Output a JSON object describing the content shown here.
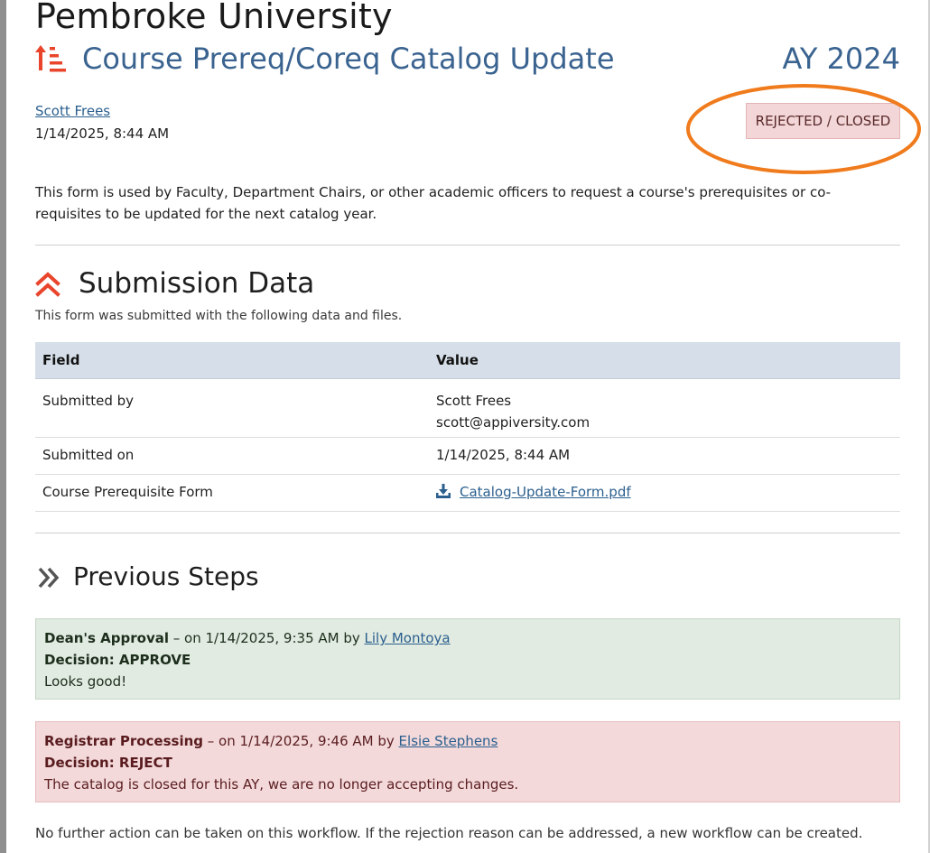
{
  "header": {
    "university": "Pembroke University",
    "course_title": "Course Prereq/Coreq Catalog Update",
    "academic_year": "AY 2024"
  },
  "submission_meta": {
    "submitter_name": "Scott Frees",
    "submitted_at": "1/14/2025, 8:44 AM",
    "status": "REJECTED / CLOSED"
  },
  "description": "This form is used by Faculty, Department Chairs, or other academic officers to request a course's prerequisites or co-requisites to be updated for the next catalog year.",
  "submission_data": {
    "title": "Submission Data",
    "subtitle": "This form was submitted with the following data and files.",
    "headers": [
      "Field",
      "Value"
    ],
    "rows": [
      {
        "field": "Submitted by",
        "value_line1": "Scott Frees",
        "value_line2": "scott@appiversity.com"
      },
      {
        "field": "Submitted on",
        "value": "1/14/2025, 8:44 AM"
      },
      {
        "field": "Course Prerequisite Form",
        "file_name": "Catalog-Update-Form.pdf"
      }
    ]
  },
  "previous_steps": {
    "title": "Previous Steps",
    "steps": [
      {
        "name": "Dean's Approval",
        "meta": " – on 1/14/2025, 9:35 AM by ",
        "actor": "Lily Montoya",
        "decision": "Decision: APPROVE",
        "comment": "Looks good!"
      },
      {
        "name": "Registrar Processing",
        "meta": " – on 1/14/2025, 9:46 AM by ",
        "actor": "Elsie Stephens",
        "decision": "Decision: REJECT",
        "comment": "The catalog is closed for this AY, we are no longer accepting changes."
      }
    ]
  },
  "footer_note": "No further action can be taken on this workflow. If the rejection reason can be addressed, a new workflow can be created.",
  "colors": {
    "accent_red": "#e8452c",
    "title_blue": "#3a6390",
    "highlight_orange": "#f07b1c",
    "approve_bg": "#e1ebe1",
    "reject_bg": "#f3d9da"
  },
  "icons": {
    "title": "sort-ascending-icon",
    "submission": "double-chevron-up-icon",
    "steps": "double-chevron-right-icon",
    "file": "download-icon"
  }
}
